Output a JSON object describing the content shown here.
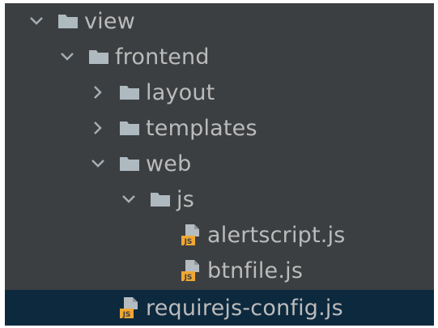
{
  "colors": {
    "panel_bg": "#3c3f41",
    "selection_bg": "#0d293e",
    "text": "#bbbbbb",
    "folder": "#aeb9c0",
    "chevron": "#a7aeb3",
    "js_badge": "#f0a732"
  },
  "tree": {
    "items": [
      {
        "label": "view",
        "type": "folder",
        "expanded": true,
        "icon": "folder-icon"
      },
      {
        "label": "frontend",
        "type": "folder",
        "expanded": true,
        "icon": "folder-icon"
      },
      {
        "label": "layout",
        "type": "folder",
        "expanded": false,
        "icon": "folder-icon"
      },
      {
        "label": "templates",
        "type": "folder",
        "expanded": false,
        "icon": "folder-icon"
      },
      {
        "label": "web",
        "type": "folder",
        "expanded": true,
        "icon": "folder-icon"
      },
      {
        "label": "js",
        "type": "folder",
        "expanded": true,
        "icon": "folder-icon"
      },
      {
        "label": "alertscript.js",
        "type": "file",
        "icon": "js-file-icon"
      },
      {
        "label": "btnfile.js",
        "type": "file",
        "icon": "js-file-icon"
      },
      {
        "label": "requirejs-config.js",
        "type": "file",
        "icon": "js-file-icon",
        "selected": true
      }
    ]
  }
}
